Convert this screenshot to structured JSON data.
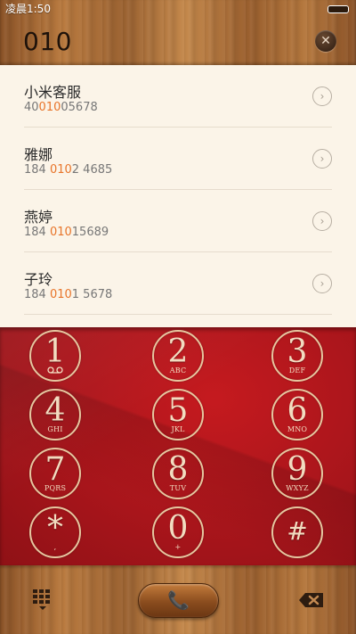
{
  "status": {
    "time": "凌晨1:50"
  },
  "dialer": {
    "number": "010",
    "clear_icon": "close-icon"
  },
  "results": [
    {
      "name": "小米客服",
      "pre": "40",
      "hl": "010",
      "post": "05678"
    },
    {
      "name": "雅娜",
      "pre": "184 ",
      "hl": "010",
      "post": "2 4685"
    },
    {
      "name": "燕婷",
      "pre": "184 ",
      "hl": "010",
      "post": "15689"
    },
    {
      "name": "子玲",
      "pre": "184 ",
      "hl": "010",
      "post": "1 5678"
    }
  ],
  "keypad": [
    {
      "digit": "1",
      "letters": "voicemail-icon"
    },
    {
      "digit": "2",
      "letters": "ABC"
    },
    {
      "digit": "3",
      "letters": "DEF"
    },
    {
      "digit": "4",
      "letters": "GHI"
    },
    {
      "digit": "5",
      "letters": "JKL"
    },
    {
      "digit": "6",
      "letters": "MNO"
    },
    {
      "digit": "7",
      "letters": "PQRS"
    },
    {
      "digit": "8",
      "letters": "TUV"
    },
    {
      "digit": "9",
      "letters": "WXYZ"
    },
    {
      "digit": "*",
      "letters": ","
    },
    {
      "digit": "0",
      "letters": "+"
    },
    {
      "digit": "#",
      "letters": ""
    }
  ],
  "colors": {
    "highlight": "#e8752a",
    "keypad_red": "#b3161c"
  },
  "bottom": {
    "call_icon": "phone-icon",
    "keypad_toggle_icon": "dialpad-icon",
    "backspace_icon": "backspace-icon"
  }
}
